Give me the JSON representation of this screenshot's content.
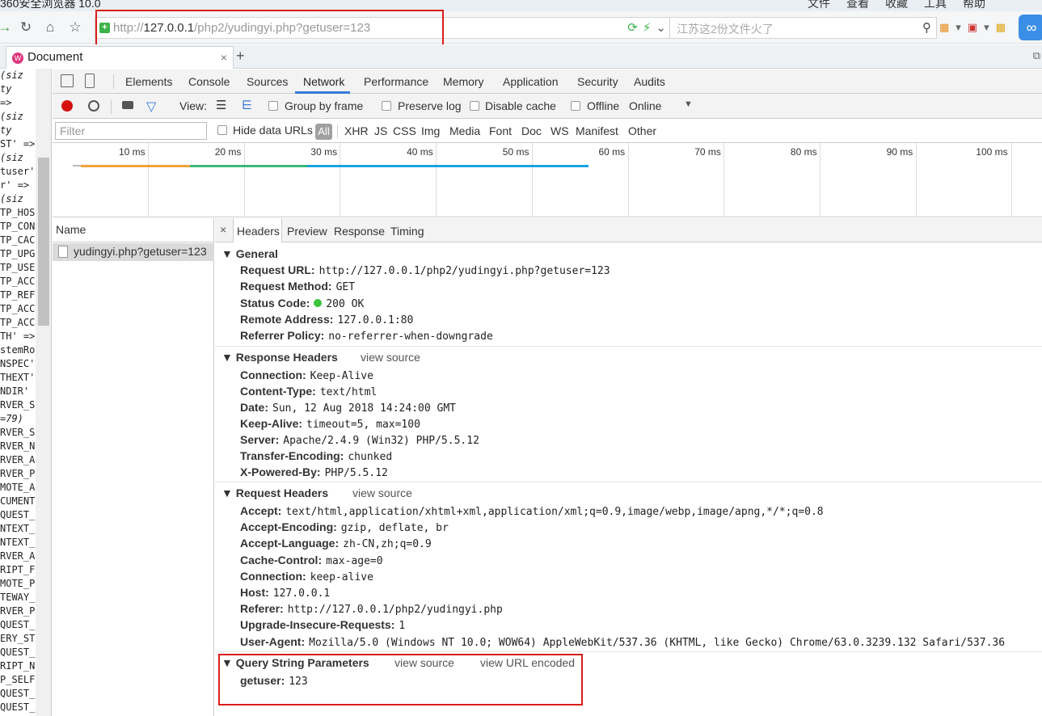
{
  "window": {
    "title": "360安全浏览器 10.0",
    "menu": [
      "文件",
      "查看",
      "收藏",
      "工具",
      "帮助"
    ]
  },
  "address": {
    "url_scheme_prefix": "http://",
    "url_host": "127.0.0.1",
    "url_path": "/php2/yudingyi.php?getuser=123"
  },
  "search": {
    "placeholder": "江苏这2份文件火了"
  },
  "tab": {
    "title": "Document"
  },
  "page_lines": [
    {
      "text": " (siz",
      "italic": true
    },
    {
      "text": "ty",
      "italic": true
    },
    {
      "text": "=>",
      "italic": false
    },
    {
      "text": " (siz",
      "italic": true
    },
    {
      "text": "ty",
      "italic": true
    },
    {
      "text": "ST' =>",
      "italic": false
    },
    {
      "text": " (siz",
      "italic": true
    },
    {
      "text": "tuser'",
      "italic": false
    },
    {
      "text": "r' =>",
      "italic": false
    },
    {
      "text": " (siz",
      "italic": true
    },
    {
      "text": "TP_HOS",
      "italic": false
    },
    {
      "text": "TP_CON",
      "italic": false
    },
    {
      "text": "TP_CAC",
      "italic": false
    },
    {
      "text": "TP_UPG",
      "italic": false
    },
    {
      "text": "TP_USE",
      "italic": false
    },
    {
      "text": "TP_ACC",
      "italic": false
    },
    {
      "text": "TP_REF",
      "italic": false
    },
    {
      "text": "TP_ACC",
      "italic": false
    },
    {
      "text": "TP_ACC",
      "italic": false
    },
    {
      "text": "TH' =>",
      "italic": false
    },
    {
      "text": "stemRo",
      "italic": false
    },
    {
      "text": "NSPEC'",
      "italic": false
    },
    {
      "text": "THEXT'",
      "italic": false
    },
    {
      "text": "NDIR'",
      "italic": false
    },
    {
      "text": "RVER_S",
      "italic": false
    },
    {
      "text": "=79)",
      "italic": true
    },
    {
      "text": "RVER_S",
      "italic": false
    },
    {
      "text": "RVER_N",
      "italic": false
    },
    {
      "text": "RVER_A",
      "italic": false
    },
    {
      "text": "RVER_P",
      "italic": false
    },
    {
      "text": "MOTE_A",
      "italic": false
    },
    {
      "text": "CUMENT",
      "italic": false
    },
    {
      "text": "QUEST_",
      "italic": false
    },
    {
      "text": "NTEXT_",
      "italic": false
    },
    {
      "text": "NTEXT_",
      "italic": false
    },
    {
      "text": "RVER_A",
      "italic": false
    },
    {
      "text": "RIPT_F",
      "italic": false
    },
    {
      "text": "MOTE_P",
      "italic": false
    },
    {
      "text": "TEWAY_",
      "italic": false
    },
    {
      "text": "RVER_P",
      "italic": false
    },
    {
      "text": "QUEST_",
      "italic": false
    },
    {
      "text": "ERY_ST",
      "italic": false
    },
    {
      "text": "QUEST_",
      "italic": false
    },
    {
      "text": "RIPT_N",
      "italic": false
    },
    {
      "text": "P_SELF",
      "italic": false
    },
    {
      "text": "QUEST_",
      "italic": false
    },
    {
      "text": "QUEST_",
      "italic": false
    }
  ],
  "devtools": {
    "tabs": [
      "Elements",
      "Console",
      "Sources",
      "Network",
      "Performance",
      "Memory",
      "Application",
      "Security",
      "Audits"
    ],
    "selected_tab": "Network",
    "toolbar": {
      "view": "View:",
      "group_by_frame": "Group by frame",
      "preserve_log": "Preserve log",
      "disable_cache": "Disable cache",
      "offline": "Offline",
      "throttle": "Online"
    },
    "filter": {
      "placeholder": "Filter",
      "hide_data_urls": "Hide data URLs",
      "types": [
        "All",
        "XHR",
        "JS",
        "CSS",
        "Img",
        "Media",
        "Font",
        "Doc",
        "WS",
        "Manifest",
        "Other"
      ]
    },
    "timeline": {
      "ticks": [
        "10 ms",
        "20 ms",
        "30 ms",
        "40 ms",
        "50 ms",
        "60 ms",
        "70 ms",
        "80 ms",
        "90 ms",
        "100 ms"
      ]
    },
    "name_header": "Name",
    "request_name": "yudingyi.php?getuser=123",
    "detail_tabs": [
      "Headers",
      "Preview",
      "Response",
      "Timing"
    ],
    "close": "×",
    "general": {
      "title": "General",
      "rows": [
        {
          "k": "Request URL:",
          "v": "http://127.0.0.1/php2/yudingyi.php?getuser=123"
        },
        {
          "k": "Request Method:",
          "v": "GET"
        },
        {
          "k": "Status Code:",
          "v": "200 OK"
        },
        {
          "k": "Remote Address:",
          "v": "127.0.0.1:80"
        },
        {
          "k": "Referrer Policy:",
          "v": "no-referrer-when-downgrade"
        }
      ]
    },
    "response": {
      "title": "Response Headers",
      "view_source": "view source",
      "rows": [
        {
          "k": "Connection:",
          "v": "Keep-Alive"
        },
        {
          "k": "Content-Type:",
          "v": "text/html"
        },
        {
          "k": "Date:",
          "v": "Sun, 12 Aug 2018 14:24:00 GMT"
        },
        {
          "k": "Keep-Alive:",
          "v": "timeout=5, max=100"
        },
        {
          "k": "Server:",
          "v": "Apache/2.4.9 (Win32) PHP/5.5.12"
        },
        {
          "k": "Transfer-Encoding:",
          "v": "chunked"
        },
        {
          "k": "X-Powered-By:",
          "v": "PHP/5.5.12"
        }
      ]
    },
    "request": {
      "title": "Request Headers",
      "view_source": "view source",
      "rows": [
        {
          "k": "Accept:",
          "v": "text/html,application/xhtml+xml,application/xml;q=0.9,image/webp,image/apng,*/*;q=0.8"
        },
        {
          "k": "Accept-Encoding:",
          "v": "gzip, deflate, br"
        },
        {
          "k": "Accept-Language:",
          "v": "zh-CN,zh;q=0.9"
        },
        {
          "k": "Cache-Control:",
          "v": "max-age=0"
        },
        {
          "k": "Connection:",
          "v": "keep-alive"
        },
        {
          "k": "Host:",
          "v": "127.0.0.1"
        },
        {
          "k": "Referer:",
          "v": "http://127.0.0.1/php2/yudingyi.php"
        },
        {
          "k": "Upgrade-Insecure-Requests:",
          "v": "1"
        },
        {
          "k": "User-Agent:",
          "v": "Mozilla/5.0 (Windows NT 10.0; WOW64) AppleWebKit/537.36 (KHTML, like Gecko) Chrome/63.0.3239.132 Safari/537.36"
        }
      ]
    },
    "query": {
      "title": "Query String Parameters",
      "view_source": "view source",
      "view_url_encoded": "view URL encoded",
      "rows": [
        {
          "k": "getuser:",
          "v": "123"
        }
      ]
    }
  }
}
